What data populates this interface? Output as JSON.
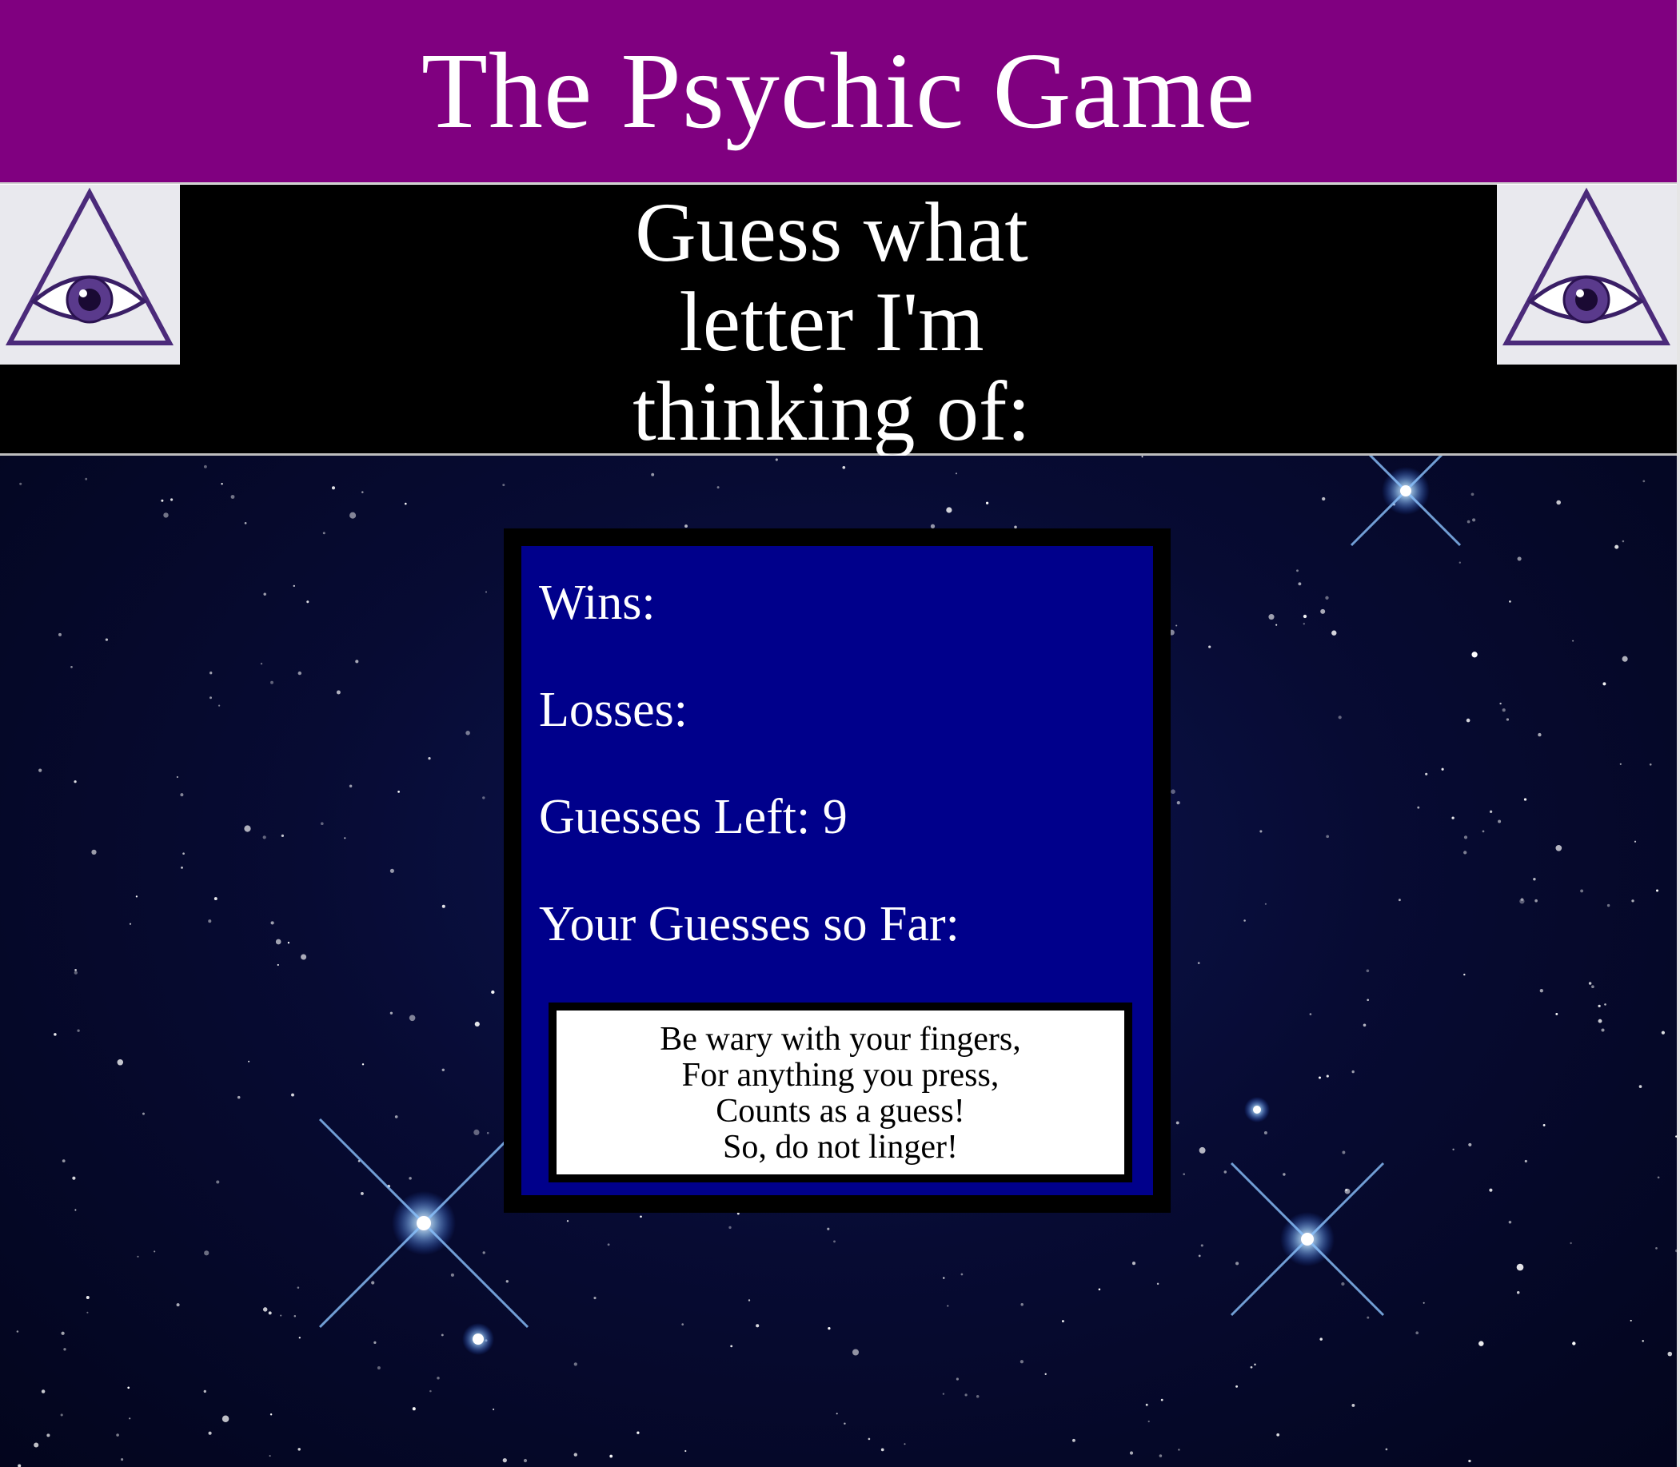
{
  "header": {
    "title": "The Psychic Game",
    "background_color": "#800080"
  },
  "banner": {
    "subtitle_lines": [
      "Guess what",
      "letter I'm",
      "thinking of:"
    ],
    "logo_icon": "all-seeing-eye-icon"
  },
  "scoreboard": {
    "wins_label": "Wins:",
    "wins_value": "",
    "losses_label": "Losses:",
    "losses_value": "",
    "guesses_left_label": "Guesses Left:",
    "guesses_left_value": "9",
    "guesses_so_far_label": "Your Guesses so Far:",
    "guesses_so_far_value": "",
    "background_color": "#00008b"
  },
  "rhyme": {
    "lines": [
      "Be wary with your fingers,",
      "For anything you press,",
      "Counts as a guess!",
      "So, do not linger!"
    ]
  }
}
